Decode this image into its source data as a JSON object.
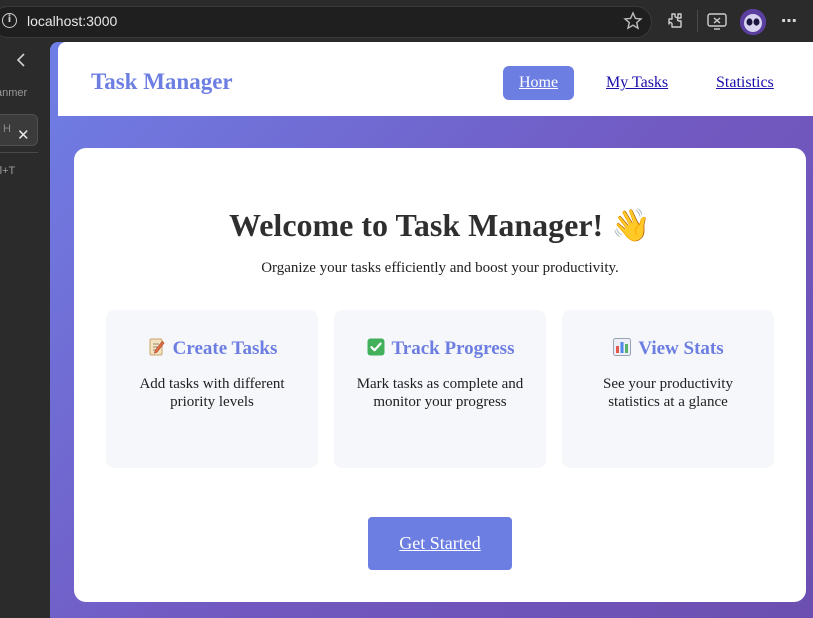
{
  "browser": {
    "url": "localhost:3000",
    "info_icon": "i",
    "more_label": "⋯"
  },
  "sidebar": {
    "tab_title": "anmer",
    "tab_label": "H",
    "close_glyph": "✕",
    "shortcut": "rl+T"
  },
  "nav": {
    "brand": "Task Manager",
    "links": [
      "Home",
      "My Tasks",
      "Statistics"
    ],
    "active": "Home"
  },
  "hero": {
    "title": "Welcome to Task Manager! 👋",
    "subtitle": "Organize your tasks efficiently and boost your productivity."
  },
  "features": [
    {
      "icon": "memo-icon",
      "title": "Create Tasks",
      "text": "Add tasks with different priority levels"
    },
    {
      "icon": "check-box-icon",
      "title": "Track Progress",
      "text": "Mark tasks as complete and monitor your progress"
    },
    {
      "icon": "bar-chart-icon",
      "title": "View Stats",
      "text": "See your productivity statistics at a glance"
    }
  ],
  "cta": {
    "label": "Get Started"
  },
  "colors": {
    "accent": "#6c7ee1",
    "gradient_start": "#6f7fe6",
    "gradient_end": "#6c4fb0",
    "link": "#1a0dab"
  }
}
